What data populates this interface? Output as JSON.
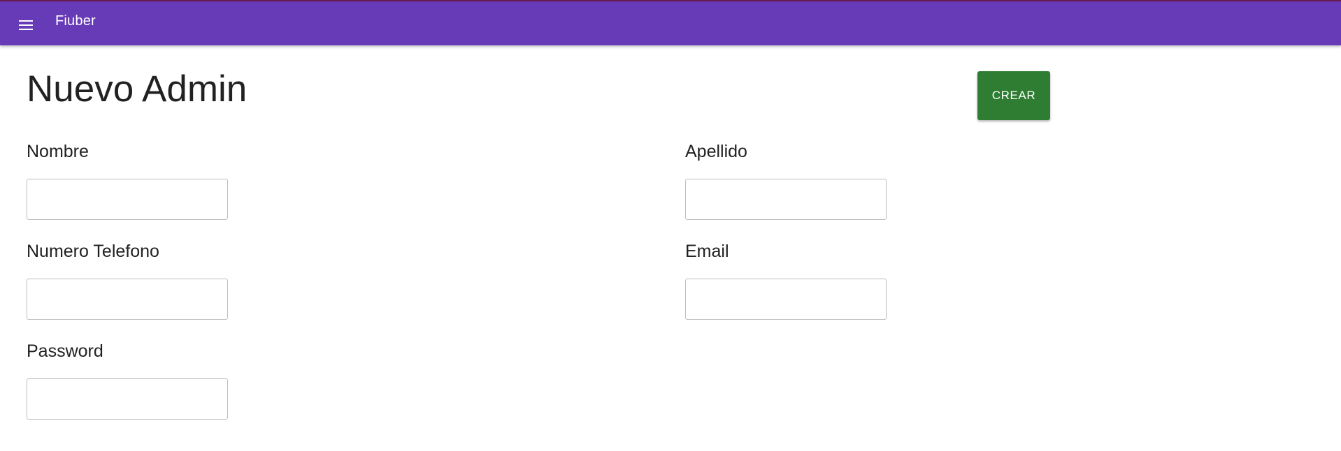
{
  "appbar": {
    "title": "Fiuber",
    "menu_icon": "menu-icon"
  },
  "page": {
    "title": "Nuevo Admin",
    "submit_label": "CREAR"
  },
  "form": {
    "nombre": {
      "label": "Nombre",
      "value": ""
    },
    "apellido": {
      "label": "Apellido",
      "value": ""
    },
    "telefono": {
      "label": "Numero Telefono",
      "value": ""
    },
    "email": {
      "label": "Email",
      "value": ""
    },
    "password": {
      "label": "Password",
      "value": ""
    }
  },
  "colors": {
    "appbar": "#673ab7",
    "submit_button": "#2e7d32"
  }
}
